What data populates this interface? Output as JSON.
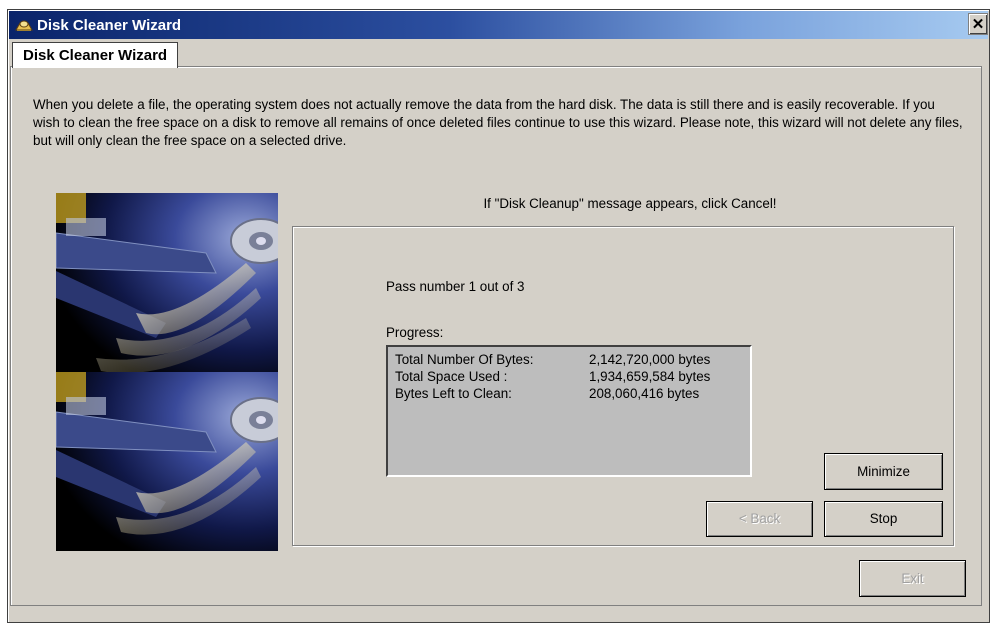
{
  "window": {
    "title": "Disk Cleaner Wizard",
    "close_glyph": "✕"
  },
  "tab": {
    "label": "Disk Cleaner Wizard"
  },
  "intro_text": "When you delete a file, the operating system does not actually remove the data from the hard disk. The data is still there and is easily recoverable. If you wish to clean the free space on a disk to remove all remains of once deleted files continue to use this wizard. Please note, this wizard will not delete any files, but will only clean the free space on a selected drive.",
  "notice": "If \"Disk Cleanup\" message appears, click Cancel!",
  "progress": {
    "pass_text": "Pass number 1 out of 3",
    "label": "Progress:",
    "rows": [
      {
        "key": "Total Number Of Bytes:",
        "value": "2,142,720,000 bytes"
      },
      {
        "key": "Total Space Used :",
        "value": "1,934,659,584 bytes"
      },
      {
        "key": "Bytes Left to Clean:",
        "value": "208,060,416 bytes"
      }
    ]
  },
  "buttons": {
    "minimize": "Minimize",
    "back": "< Back",
    "stop": "Stop",
    "exit": "Exit"
  },
  "colors": {
    "window_bg": "#d4d0c8",
    "title_start": "#0a246a",
    "title_end": "#a6caf0",
    "stats_bg": "#bdbdbd"
  },
  "icons": {
    "app": "disk-cleaner-icon",
    "close": "close-icon",
    "illustration": "hard-disk-illustration"
  }
}
